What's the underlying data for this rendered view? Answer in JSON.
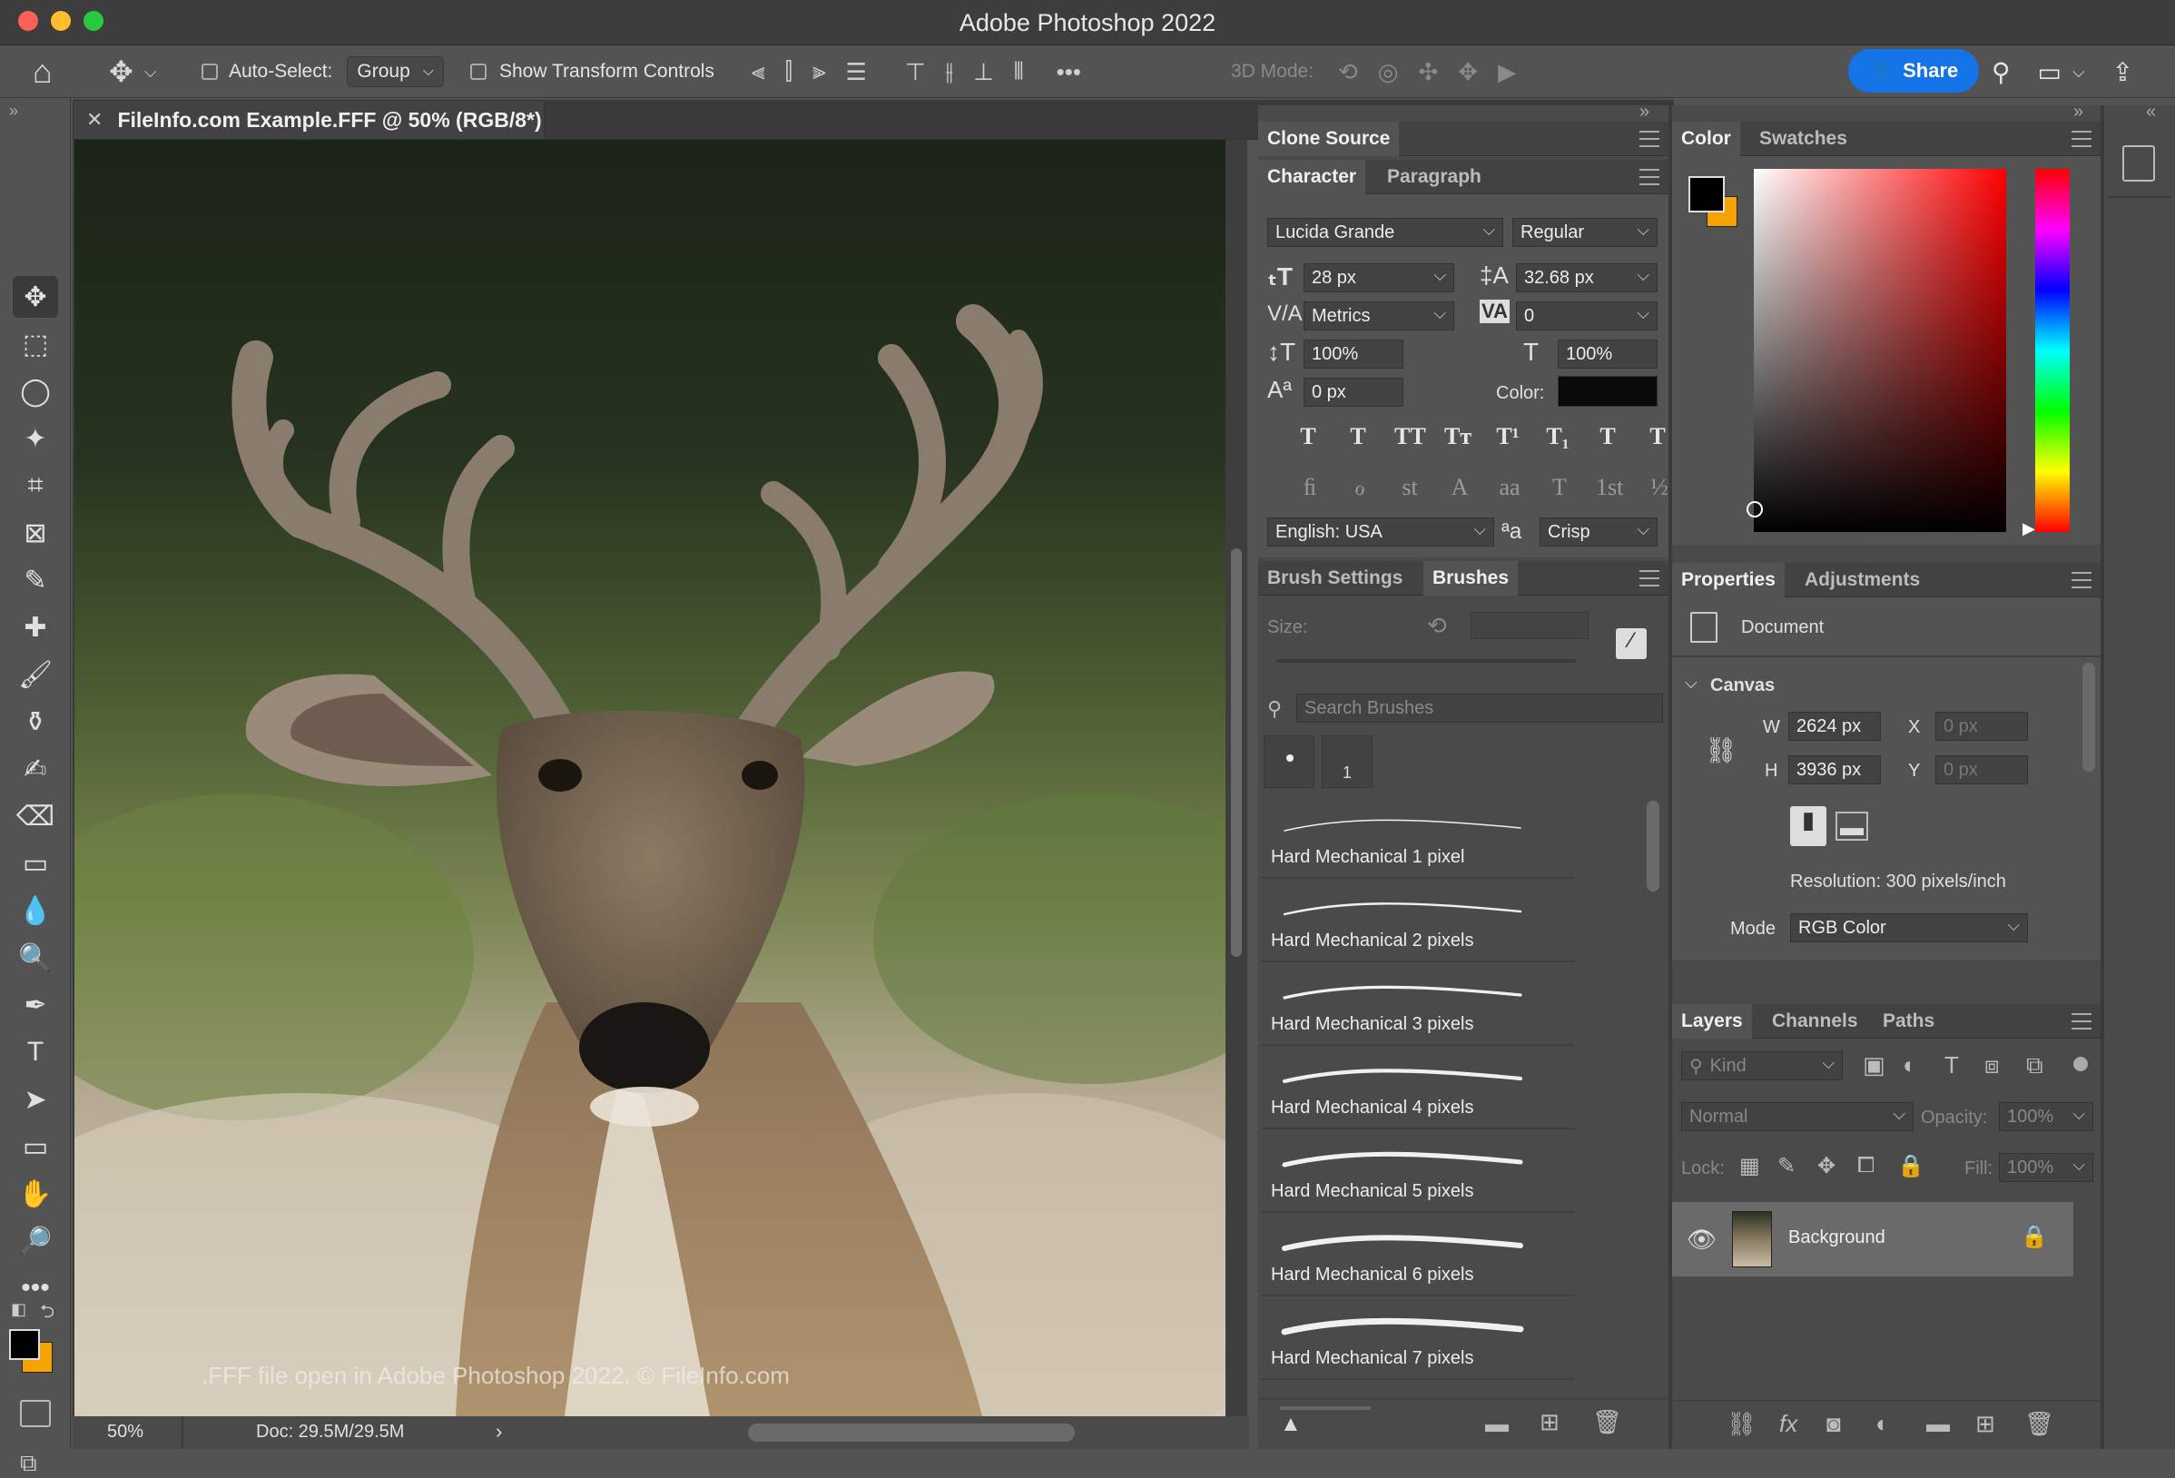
{
  "app": {
    "title": "Adobe Photoshop 2022"
  },
  "options": {
    "auto_select_label": "Auto-Select:",
    "auto_select_value": "Group",
    "show_transform_label": "Show Transform Controls",
    "mode_3d_label": "3D Mode:",
    "share_label": "Share"
  },
  "document": {
    "tab_title": "FileInfo.com Example.FFF @ 50% (RGB/8*)",
    "watermark": ".FFF file open in Adobe Photoshop 2022. © FileInfo.com",
    "zoom": "50%",
    "doc_size": "Doc: 29.5M/29.5M"
  },
  "clone_panel": {
    "tab": "Clone Source"
  },
  "character": {
    "tabs": [
      "Character",
      "Paragraph"
    ],
    "font_family": "Lucida Grande",
    "font_style": "Regular",
    "size": "28 px",
    "leading": "32.68 px",
    "kerning": "Metrics",
    "tracking": "0",
    "vscale": "100%",
    "hscale": "100%",
    "baseline": "0 px",
    "color_label": "Color:",
    "color_value": "#0a0a0a",
    "style_row1": [
      "T",
      "T",
      "TT",
      "Tт",
      "T¹",
      "T₁",
      "T",
      "T"
    ],
    "style_row2": [
      "ﬁ",
      "ℴ",
      "st",
      "A",
      "aa",
      "T",
      "1st",
      "½"
    ],
    "language": "English: USA",
    "aa_glyph": "ªa",
    "antialias": "Crisp"
  },
  "brushes": {
    "tabs": [
      "Brush Settings",
      "Brushes"
    ],
    "size_label": "Size:",
    "search_placeholder": "Search Brushes",
    "preset_number": "1",
    "items": [
      {
        "name": "Hard Mechanical 1 pixel",
        "stroke": 1
      },
      {
        "name": "Hard Mechanical 2 pixels",
        "stroke": 2
      },
      {
        "name": "Hard Mechanical 3 pixels",
        "stroke": 3
      },
      {
        "name": "Hard Mechanical 4 pixels",
        "stroke": 4
      },
      {
        "name": "Hard Mechanical 5 pixels",
        "stroke": 5
      },
      {
        "name": "Hard Mechanical 6 pixels",
        "stroke": 6
      },
      {
        "name": "Hard Mechanical 7 pixels",
        "stroke": 7
      }
    ]
  },
  "color_panel": {
    "tabs": [
      "Color",
      "Swatches"
    ],
    "foreground": "#000000",
    "background": "#f4a300",
    "picker_hue": "#ff0000"
  },
  "properties": {
    "tabs": [
      "Properties",
      "Adjustments"
    ],
    "doc_label": "Document",
    "canvas_label": "Canvas",
    "w_label": "W",
    "w_value": "2624 px",
    "h_label": "H",
    "h_value": "3936 px",
    "x_label": "X",
    "x_value": "0 px",
    "y_label": "Y",
    "y_value": "0 px",
    "resolution": "Resolution: 300 pixels/inch",
    "mode_label": "Mode",
    "mode_value": "RGB Color"
  },
  "layers": {
    "tabs": [
      "Layers",
      "Channels",
      "Paths"
    ],
    "kind": "Kind",
    "blend": "Normal",
    "opacity_label": "Opacity:",
    "opacity_value": "100%",
    "lock_label": "Lock:",
    "fill_label": "Fill:",
    "fill_value": "100%",
    "layer_name": "Background"
  },
  "tools": [
    "move-tool",
    "marquee-tool",
    "lasso-tool",
    "magic-wand-tool",
    "crop-tool",
    "frame-tool",
    "eyedropper-tool",
    "healing-tool",
    "brush-tool",
    "stamp-tool",
    "history-brush-tool",
    "eraser-tool",
    "gradient-tool",
    "blur-tool",
    "dodge-tool",
    "pen-tool",
    "type-tool",
    "path-select-tool",
    "rectangle-tool",
    "hand-tool",
    "zoom-tool",
    "more-tools"
  ],
  "tool_glyphs": [
    "✥",
    "⬚",
    "◯",
    "✦",
    "⌗",
    "⊠",
    "✎",
    "✚",
    "🖌",
    "⚱",
    "✍",
    "⌫",
    "▭",
    "💧",
    "🔍",
    "✒",
    "T",
    "➤",
    "▭",
    "✋",
    "🔎",
    "•••"
  ]
}
